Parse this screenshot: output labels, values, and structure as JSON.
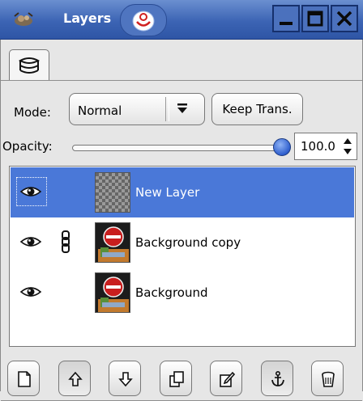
{
  "window": {
    "title": "Layers",
    "app_icon": "gimp-icon",
    "extra_icon": "swirl-icon",
    "controls": [
      "minimize-icon",
      "maximize-icon",
      "close-icon"
    ]
  },
  "tab": {
    "icon": "layers-stack-icon"
  },
  "mode": {
    "label": "Mode:",
    "value": "Normal"
  },
  "keep_trans": {
    "label": "Keep Trans."
  },
  "opacity": {
    "label": "Opacity:",
    "value": "100.0",
    "fraction": 1.0
  },
  "layers": [
    {
      "name": "New Layer",
      "visible": true,
      "linked": false,
      "selected": true,
      "thumbnail": "transparent-checker"
    },
    {
      "name": "Background copy",
      "visible": true,
      "linked": true,
      "selected": false,
      "thumbnail": "no-entry-sign-photo"
    },
    {
      "name": "Background",
      "visible": true,
      "linked": false,
      "selected": false,
      "thumbnail": "no-entry-sign-photo"
    }
  ],
  "toolbar": [
    {
      "name": "new-layer-button",
      "icon": "new-page-icon"
    },
    {
      "name": "raise-layer-button",
      "icon": "arrow-up-icon"
    },
    {
      "name": "lower-layer-button",
      "icon": "arrow-down-icon"
    },
    {
      "name": "duplicate-layer-button",
      "icon": "duplicate-icon"
    },
    {
      "name": "edit-layer-button",
      "icon": "edit-icon"
    },
    {
      "name": "anchor-layer-button",
      "icon": "anchor-icon"
    },
    {
      "name": "delete-layer-button",
      "icon": "trash-icon"
    }
  ],
  "colors": {
    "selection": "#4a78d8",
    "titlebar": "#3c64b4",
    "knob": "#2f5fce"
  }
}
